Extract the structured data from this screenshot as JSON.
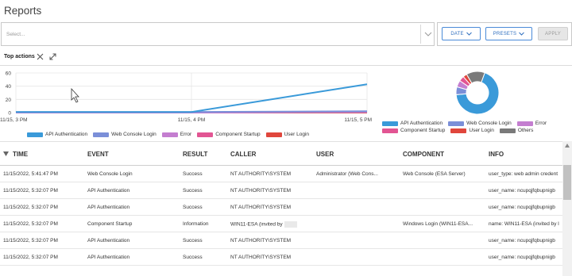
{
  "page": {
    "title": "Reports"
  },
  "filter": {
    "placeholder": "Select..."
  },
  "buttons": {
    "date": "DATE",
    "presets": "PRESETS",
    "apply": "APPLY"
  },
  "top_actions": {
    "title": "Top actions"
  },
  "chart_data": [
    {
      "type": "line",
      "x": [
        "11/15, 3 PM",
        "11/15, 4 PM",
        "11/15, 5 PM"
      ],
      "ylim": [
        0,
        60
      ],
      "yticks": [
        "60",
        "40",
        "20",
        "0"
      ],
      "series": [
        {
          "name": "API Authentication",
          "color": "#3a9ad9",
          "points": [
            [
              0,
              1
            ],
            [
              1,
              1
            ],
            [
              2,
              43
            ]
          ]
        },
        {
          "name": "Web Console Login",
          "color": "#7b8fd8",
          "points": [
            [
              0,
              1
            ],
            [
              1,
              1
            ],
            [
              2,
              2
            ]
          ]
        },
        {
          "name": "Error",
          "color": "#c47ed0",
          "points": [
            [
              0,
              0
            ],
            [
              1,
              0
            ],
            [
              2,
              1
            ]
          ]
        },
        {
          "name": "Component Startup",
          "color": "#e25593",
          "points": [
            [
              0,
              0
            ],
            [
              1,
              0
            ],
            [
              2,
              1
            ]
          ]
        },
        {
          "name": "User Login",
          "color": "#e0463c",
          "points": [
            [
              0,
              0
            ],
            [
              1,
              0
            ],
            [
              2,
              0
            ]
          ]
        }
      ]
    },
    {
      "type": "pie",
      "donut": true,
      "slices": [
        {
          "name": "API Authentication",
          "value": 68,
          "color": "#3a9ad9"
        },
        {
          "name": "Web Console Login",
          "value": 6,
          "color": "#7b8fd8"
        },
        {
          "name": "Error",
          "value": 5,
          "color": "#c47ed0"
        },
        {
          "name": "Component Startup",
          "value": 4,
          "color": "#e25593"
        },
        {
          "name": "User Login",
          "value": 3,
          "color": "#e0463c"
        },
        {
          "name": "Others",
          "value": 14,
          "color": "#7a7a7a"
        }
      ]
    }
  ],
  "legend_line": [
    {
      "label": "API Authentication",
      "color": "#3a9ad9"
    },
    {
      "label": "Web Console Login",
      "color": "#7b8fd8"
    },
    {
      "label": "Error",
      "color": "#c47ed0"
    },
    {
      "label": "Component Startup",
      "color": "#e25593"
    },
    {
      "label": "User Login",
      "color": "#e0463c"
    }
  ],
  "legend_donut": [
    {
      "label": "API Authentication",
      "color": "#3a9ad9"
    },
    {
      "label": "Web Console Login",
      "color": "#7b8fd8"
    },
    {
      "label": "Error",
      "color": "#c47ed0"
    },
    {
      "label": "Component Startup",
      "color": "#e25593"
    },
    {
      "label": "User Login",
      "color": "#e0463c"
    },
    {
      "label": "Others",
      "color": "#7a7a7a"
    }
  ],
  "table": {
    "headers": [
      "TIME",
      "EVENT",
      "RESULT",
      "CALLER",
      "USER",
      "COMPONENT",
      "INFO"
    ],
    "rows": [
      [
        "11/15/2022, 5:41:47 PM",
        "Web Console Login",
        "Success",
        "NT AUTHORITY\\SYSTEM",
        "Administrator (Web Cons...",
        "Web Console (ESA Server)",
        "user_type: web admin credent"
      ],
      [
        "11/15/2022, 5:32:07 PM",
        "API Authentication",
        "Success",
        "NT AUTHORITY\\SYSTEM",
        "",
        "",
        "user_name: ncupqjfqbupnigb"
      ],
      [
        "11/15/2022, 5:32:07 PM",
        "API Authentication",
        "Success",
        "NT AUTHORITY\\SYSTEM",
        "",
        "",
        "user_name: ncupqjfqbupnigb"
      ],
      [
        "11/15/2022, 5:32:07 PM",
        "Component Startup",
        "Information",
        "WIN11-ESA (invited by",
        "",
        "Windows Login (WIN11-ESA...",
        "name: WIN11-ESA (invited by l"
      ],
      [
        "11/15/2022, 5:32:07 PM",
        "API Authentication",
        "Success",
        "NT AUTHORITY\\SYSTEM",
        "",
        "",
        "user_name: ncupqjfqbupnigb"
      ],
      [
        "11/15/2022, 5:32:07 PM",
        "API Authentication",
        "Success",
        "NT AUTHORITY\\SYSTEM",
        "",
        "",
        "user_name: ncupqjfqbupnigb"
      ]
    ]
  }
}
